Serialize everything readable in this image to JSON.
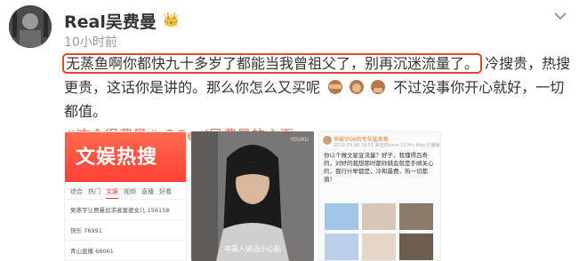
{
  "post": {
    "username": "Real吴费曼",
    "time": "10小时前",
    "text_highlighted": "无蒸鱼啊你都快九十多岁了都能当我曾祖父了，别再沉迷流量了。",
    "text_part2": "冷搜贵，热搜更贵，这话你是讲的。那么你怎么又买呢",
    "text_part3": "不过没事你开心就好，一切都值。",
    "topic_tag": "#这个很费曼#",
    "user_link": "Real吴费曼的主页"
  },
  "images": {
    "image1": {
      "banner_title": "文娱热搜",
      "tabs": [
        "综合",
        "热门",
        "文娱",
        "视频",
        "直播",
        "好看"
      ],
      "rows": [
        "吴蒸宇让费曼追求者富婆女儿  156158",
        "快乐  76991",
        "青山直播  68061"
      ]
    },
    "image2": {
      "watermark": "YOUKU",
      "caption": "年青人说话小心點"
    },
    "image3": {
      "name": "杀破宇00的专吾猛男豪",
      "meta": "2019-03-08 19:51 来自iPhone 13 Pro Max 已编辑",
      "body": "你以个做文星宣流量？好子，我懂得吕奇的，对好的我想那时都你跳会就是手顺关心的，我行什举都是，冷和最费，热一切都值！"
    }
  },
  "colors": {
    "highlight_border": "#e0472e",
    "link": "#eb7350",
    "banner": "#ff3f36"
  }
}
